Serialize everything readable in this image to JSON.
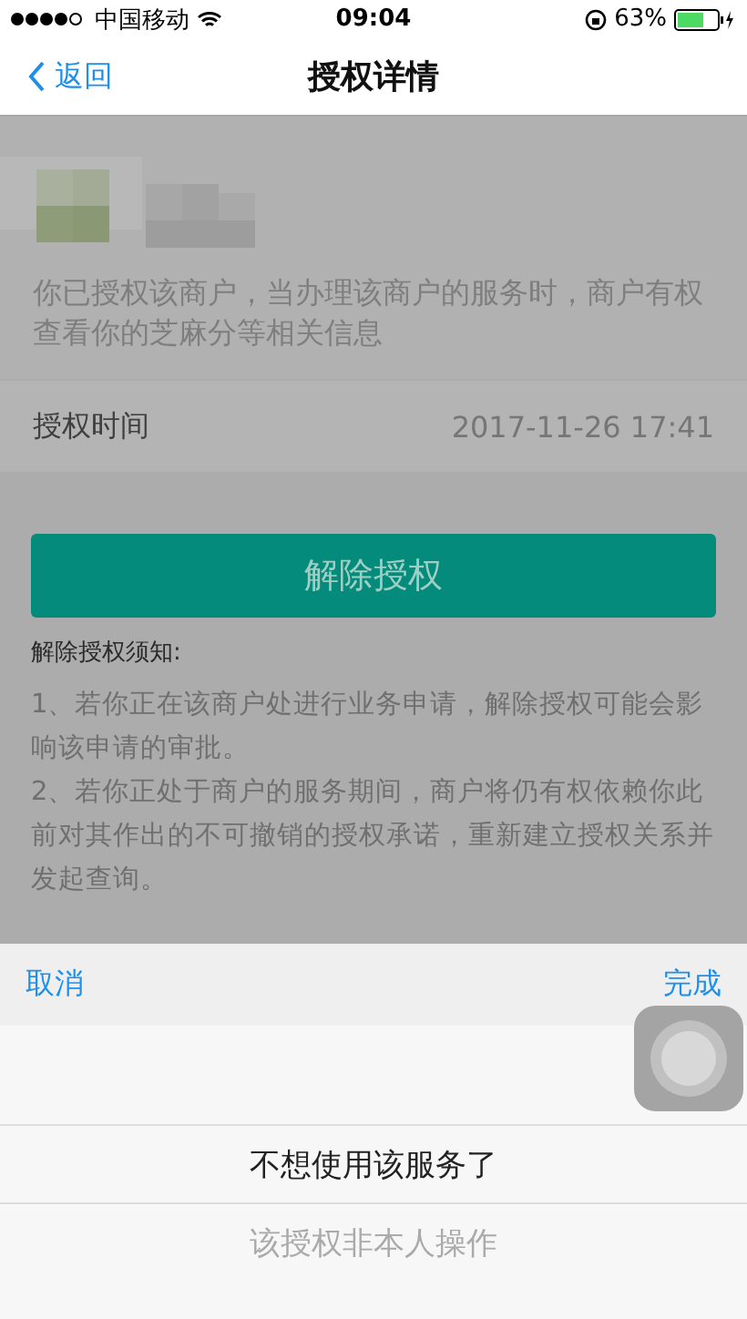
{
  "status_bar": {
    "carrier": "中国移动",
    "time": "09:04",
    "battery": "63%"
  },
  "nav": {
    "back": "返回",
    "title": "授权详情"
  },
  "merchant": {
    "description": "你已授权该商户，当办理该商户的服务时，商户有权查看你的芝麻分等相关信息"
  },
  "auth_time": {
    "label": "授权时间",
    "value": "2017-11-26 17:41"
  },
  "revoke_button": "解除授权",
  "notice": {
    "title": "解除授权须知:",
    "items": [
      "1、若你正在该商户处进行业务申请，解除授权可能会影响该申请的审批。",
      "2、若你正处于商户的服务期间，商户将仍有权依赖你此前对其作出的不可撤销的授权承诺，重新建立授权关系并发起查询。"
    ]
  },
  "picker": {
    "cancel": "取消",
    "done": "完成",
    "options": [
      {
        "label": "不想使用该服务了",
        "selected": true
      },
      {
        "label": "该授权非本人操作",
        "selected": false
      }
    ]
  }
}
